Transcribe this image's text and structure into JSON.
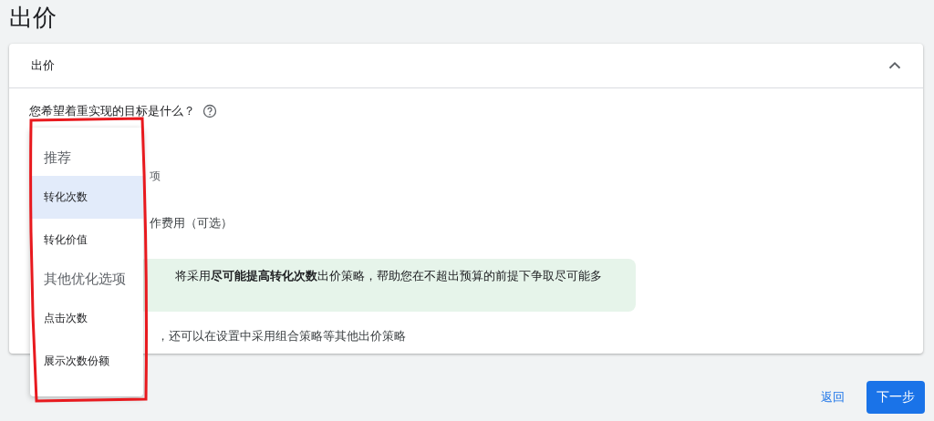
{
  "page_title": "出价",
  "card": {
    "title": "出价",
    "expanded": true,
    "question": "您希望着重实现的目标是什么？",
    "row_1": "项",
    "row_2": "作费用（可选）",
    "info": "将采用**尽可能提高转化次数**出价策略，帮助您在不超出预算的前提下争取尽可能多",
    "note": "，还可以在设置中采用组合策略等其他出价策略"
  },
  "menu": [
    {
      "kind": "header",
      "label": "推荐"
    },
    {
      "kind": "option",
      "label": "转化次数",
      "selected": true
    },
    {
      "kind": "option",
      "label": "转化价值",
      "selected": false
    },
    {
      "kind": "header",
      "label": "其他优化选项"
    },
    {
      "kind": "option",
      "label": "点击次数",
      "selected": false
    },
    {
      "kind": "option",
      "label": "展示次数份额",
      "selected": false
    }
  ],
  "footer": {
    "back": "返回",
    "next": "下一步"
  }
}
